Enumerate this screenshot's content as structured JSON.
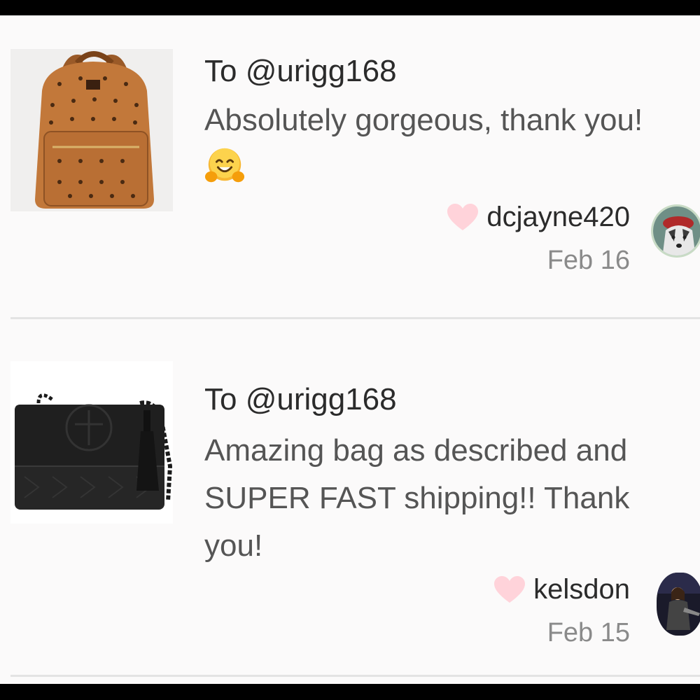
{
  "reviews": [
    {
      "to": "To @urigg168",
      "comment": "Absolutely gorgeous, thank you!",
      "emoji": "hugging-face",
      "username": "dcjayne420",
      "date": "Feb 16",
      "product_image": "brown-monogram-backpack",
      "avatar": "husky-dog-avatar"
    },
    {
      "to": "To @urigg168",
      "comment": "Amazing bag as described and SUPER FAST shipping!! Thank you!",
      "username": "kelsdon",
      "date": "Feb 15",
      "product_image": "black-crossbody-bag",
      "avatar": "person-photo-avatar"
    }
  ],
  "colors": {
    "heart": "#ffd3da",
    "text_primary": "#2b2b2b",
    "text_secondary": "#555555",
    "date": "#8a8a8a",
    "background": "#fbfafa",
    "divider": "#e3e3e3"
  }
}
